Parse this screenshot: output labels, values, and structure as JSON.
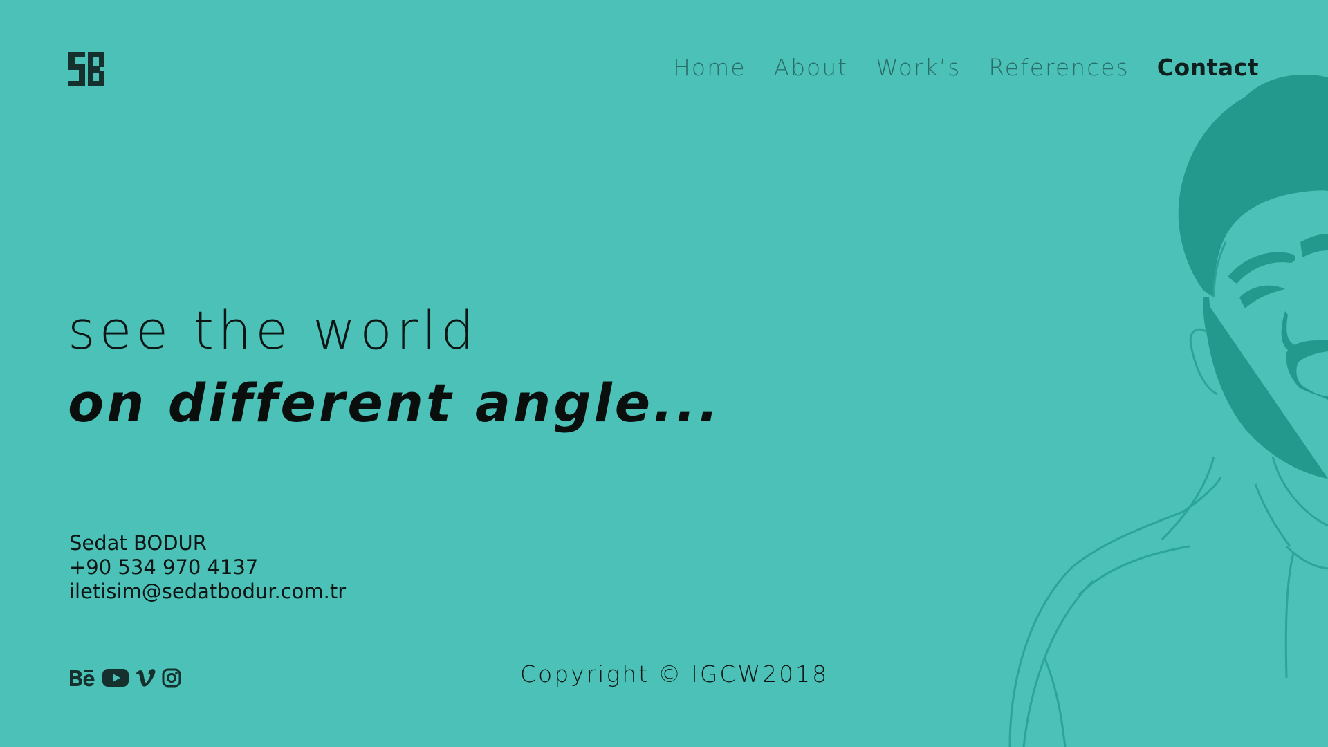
{
  "logo": {
    "alt": "SB"
  },
  "nav": {
    "items": [
      {
        "label": "Home"
      },
      {
        "label": "About"
      },
      {
        "label": "Work’s"
      },
      {
        "label": "References"
      },
      {
        "label": "Contact"
      }
    ],
    "active": "Contact"
  },
  "hero": {
    "line1": "see the world",
    "line2": "on different angle..."
  },
  "contact": {
    "name": "Sedat BODUR",
    "phone": "+90 534 970 4137",
    "email": "iletisim@sedatbodur.com.tr"
  },
  "social": {
    "icons": [
      "behance-icon",
      "youtube-icon",
      "vimeo-icon",
      "instagram-icon"
    ]
  },
  "footer": {
    "copyright_word": "Copyright",
    "copyright_symbol": "©",
    "copyright_owner": "IGCW2018"
  },
  "colors": {
    "background": "#4bc1b7",
    "portrait": "#22998c",
    "nav_text": "#2a6e68",
    "text_dark": "#0d1614"
  }
}
